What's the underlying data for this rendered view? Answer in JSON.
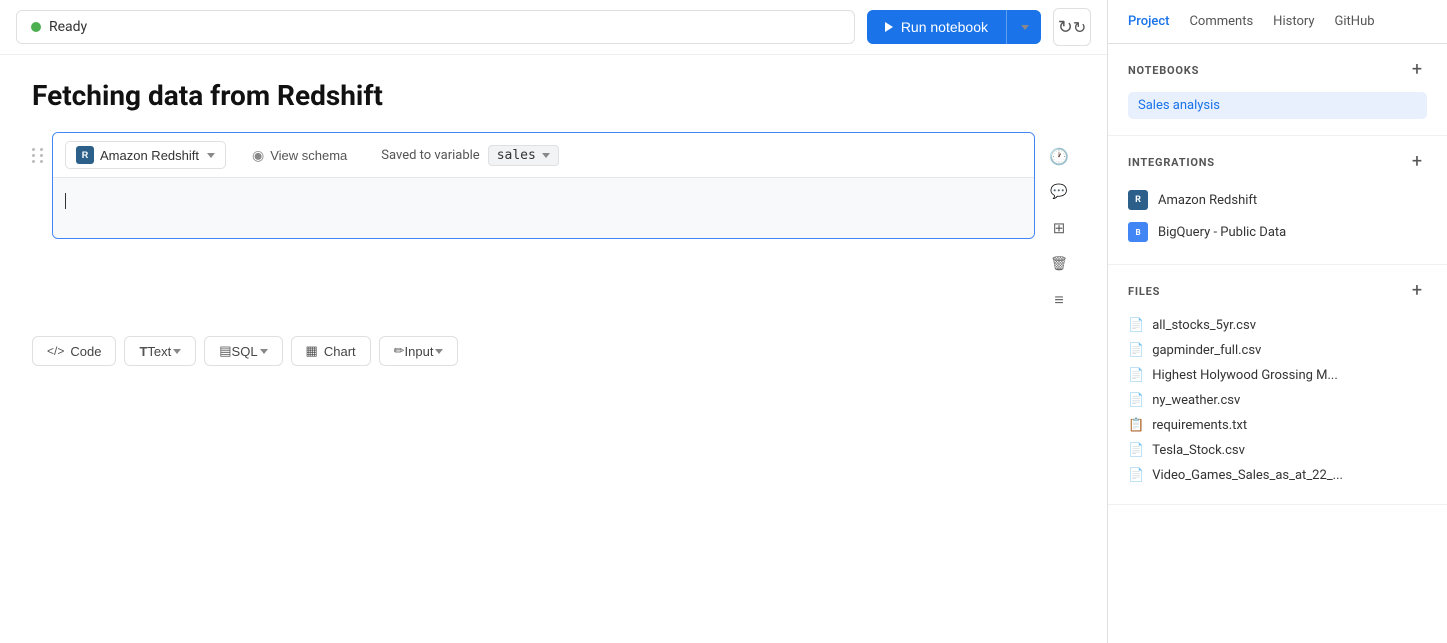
{
  "topbar": {
    "status_label": "Ready",
    "run_button_label": "Run notebook",
    "refresh_tooltip": "Refresh"
  },
  "page": {
    "title": "Fetching data from Redshift"
  },
  "cell": {
    "source_label": "Amazon Redshift",
    "view_schema_label": "View schema",
    "saved_to_label": "Saved to variable",
    "variable_name": "sales",
    "editor_placeholder": ""
  },
  "add_cell_buttons": [
    {
      "id": "code",
      "label": "Code",
      "icon": "code"
    },
    {
      "id": "text",
      "label": "Text",
      "icon": "text",
      "has_arrow": true
    },
    {
      "id": "sql",
      "label": "SQL",
      "icon": "sql",
      "has_arrow": true
    },
    {
      "id": "chart",
      "label": "Chart",
      "icon": "chart"
    },
    {
      "id": "input",
      "label": "Input",
      "icon": "input",
      "has_arrow": true
    }
  ],
  "sidebar": {
    "nav_items": [
      {
        "id": "project",
        "label": "Project",
        "active": true
      },
      {
        "id": "comments",
        "label": "Comments"
      },
      {
        "id": "history",
        "label": "History"
      },
      {
        "id": "github",
        "label": "GitHub"
      }
    ],
    "notebooks_section": {
      "title": "NOTEBOOKS",
      "items": [
        {
          "id": "sales-analysis",
          "label": "Sales analysis"
        }
      ]
    },
    "integrations_section": {
      "title": "INTEGRATIONS",
      "items": [
        {
          "id": "redshift",
          "label": "Amazon Redshift",
          "type": "redshift"
        },
        {
          "id": "bigquery",
          "label": "BigQuery - Public Data",
          "type": "bigquery"
        }
      ]
    },
    "files_section": {
      "title": "FILES",
      "items": [
        {
          "id": "all-stocks",
          "label": "all_stocks_5yr.csv",
          "type": "csv"
        },
        {
          "id": "gapminder",
          "label": "gapminder_full.csv",
          "type": "csv"
        },
        {
          "id": "hollywood",
          "label": "Highest Holywood Grossing M...",
          "type": "csv"
        },
        {
          "id": "ny-weather",
          "label": "ny_weather.csv",
          "type": "csv"
        },
        {
          "id": "requirements",
          "label": "requirements.txt",
          "type": "txt"
        },
        {
          "id": "tesla",
          "label": "Tesla_Stock.csv",
          "type": "csv"
        },
        {
          "id": "video-games",
          "label": "Video_Games_Sales_as_at_22_...",
          "type": "csv"
        }
      ]
    }
  }
}
